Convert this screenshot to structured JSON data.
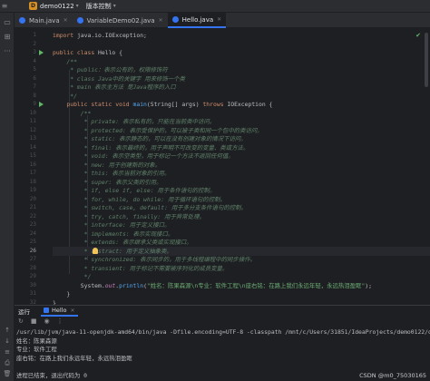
{
  "titlebar": {
    "project_initial": "D",
    "project_name": "demo0122",
    "vcs_label": "版本控制"
  },
  "tabs": [
    {
      "label": "Main.java",
      "active": false
    },
    {
      "label": "VariableDemo02.java",
      "active": false
    },
    {
      "label": "Hello.java",
      "active": true
    }
  ],
  "editor": {
    "current_line": 26,
    "lines": [
      {
        "n": 1,
        "segs": [
          [
            "kw",
            "import "
          ],
          [
            "",
            "java.io.IOException;"
          ]
        ]
      },
      {
        "n": 2,
        "segs": []
      },
      {
        "n": 3,
        "run": true,
        "segs": [
          [
            "kw",
            "public class "
          ],
          [
            "cls",
            "Hello "
          ],
          [
            "",
            "{"
          ]
        ]
      },
      {
        "n": 4,
        "segs": [
          [
            "doc",
            "    /**"
          ]
        ]
      },
      {
        "n": 5,
        "segs": [
          [
            "doc",
            "     * public：表示公有的，权限修饰符"
          ]
        ]
      },
      {
        "n": 6,
        "segs": [
          [
            "doc",
            "     * class Java中的关键字 用来修饰一个类"
          ]
        ]
      },
      {
        "n": 7,
        "segs": [
          [
            "doc",
            "     * main 表示主方法 是Java程序的入口"
          ]
        ]
      },
      {
        "n": 8,
        "segs": [
          [
            "doc",
            "     */"
          ]
        ]
      },
      {
        "n": 9,
        "run": true,
        "segs": [
          [
            "kw",
            "    public static void "
          ],
          [
            "fn",
            "main"
          ],
          [
            "",
            "(String[] args) "
          ],
          [
            "kw",
            "throws "
          ],
          [
            "",
            "IOException {"
          ]
        ]
      },
      {
        "n": 10,
        "segs": [
          [
            "doc",
            "        /**"
          ]
        ]
      },
      {
        "n": 11,
        "segs": [
          [
            "doc",
            "         * private: 表示私有的，只能在当前类中访问。"
          ]
        ]
      },
      {
        "n": 12,
        "segs": [
          [
            "doc",
            "         * protected: 表示受保护的，可以被子类和同一个包中的类访问。"
          ]
        ]
      },
      {
        "n": 13,
        "segs": [
          [
            "doc",
            "         * static: 表示静态的，可以在没有创建对象的情况下访问。"
          ]
        ]
      },
      {
        "n": 14,
        "segs": [
          [
            "doc",
            "         * final: 表示最终的，用于声明不可改变的变量、类或方法。"
          ]
        ]
      },
      {
        "n": 15,
        "segs": [
          [
            "doc",
            "         * void: 表示空类型，用于标记一个方法不返回任何值。"
          ]
        ]
      },
      {
        "n": 16,
        "segs": [
          [
            "doc",
            "         * new: 用于创建新的对象。"
          ]
        ]
      },
      {
        "n": 17,
        "segs": [
          [
            "doc",
            "         * this: 表示当前对象的引用。"
          ]
        ]
      },
      {
        "n": 18,
        "segs": [
          [
            "doc",
            "         * super: 表示父类的引用。"
          ]
        ]
      },
      {
        "n": 19,
        "segs": [
          [
            "doc",
            "         * if, else if, else: 用于条件语句的控制。"
          ]
        ]
      },
      {
        "n": 20,
        "segs": [
          [
            "doc",
            "         * for, while, do while: 用于循环语句的控制。"
          ]
        ]
      },
      {
        "n": 21,
        "segs": [
          [
            "doc",
            "         * switch, case, default: 用于多分支条件语句的控制。"
          ]
        ]
      },
      {
        "n": 22,
        "segs": [
          [
            "doc",
            "         * try, catch, finally: 用于异常处理。"
          ]
        ]
      },
      {
        "n": 23,
        "segs": [
          [
            "doc",
            "         * interface: 用于定义接口。"
          ]
        ]
      },
      {
        "n": 24,
        "segs": [
          [
            "doc",
            "         * implements: 表示实现接口。"
          ]
        ]
      },
      {
        "n": 25,
        "segs": [
          [
            "doc",
            "         * extends: 表示继承父类或实现接口。"
          ]
        ]
      },
      {
        "n": 26,
        "bulb": true,
        "segs": [
          [
            "doc",
            "         * abstract: 用于定义抽象类。"
          ]
        ]
      },
      {
        "n": 27,
        "segs": [
          [
            "doc",
            "         * synchronized: 表示同步的，用于多线程编程中的同步操作。"
          ]
        ]
      },
      {
        "n": 28,
        "segs": [
          [
            "doc",
            "         * transient: 用于标记不需要被序列化的成员变量。"
          ]
        ]
      },
      {
        "n": 29,
        "segs": [
          [
            "doc",
            "         */"
          ]
        ]
      },
      {
        "n": 30,
        "segs": [
          [
            "",
            "        System."
          ],
          [
            "fld",
            "out"
          ],
          [
            "",
            "."
          ],
          [
            "fn",
            "println"
          ],
          [
            "",
            "("
          ],
          [
            "str",
            "\"姓名：陈果森源\\n专业：软件工程\\n座右铭：在路上我们永远年轻，永远热泪盈眶\""
          ],
          [
            "",
            ");"
          ]
        ]
      },
      {
        "n": 31,
        "segs": [
          [
            "",
            "    }"
          ]
        ]
      },
      {
        "n": 32,
        "segs": [
          [
            "",
            "}"
          ]
        ]
      }
    ]
  },
  "run_panel": {
    "title": "运行",
    "tab_label": "Hello",
    "console_lines": [
      "/usr/lib/jvm/java-11-openjdk-amd64/bin/java -Dfile.encoding=UTF-8 -classpath /mnt/c/Users/31851/IdeaProjects/demo0122/out",
      "姓名：陈果森源",
      "专业：软件工程",
      "座右铭：在路上我们永远年轻，永远热泪盈眶",
      "",
      "进程已结束，退出代码为 0"
    ]
  },
  "watermark": "CSDN @m0_75030165"
}
